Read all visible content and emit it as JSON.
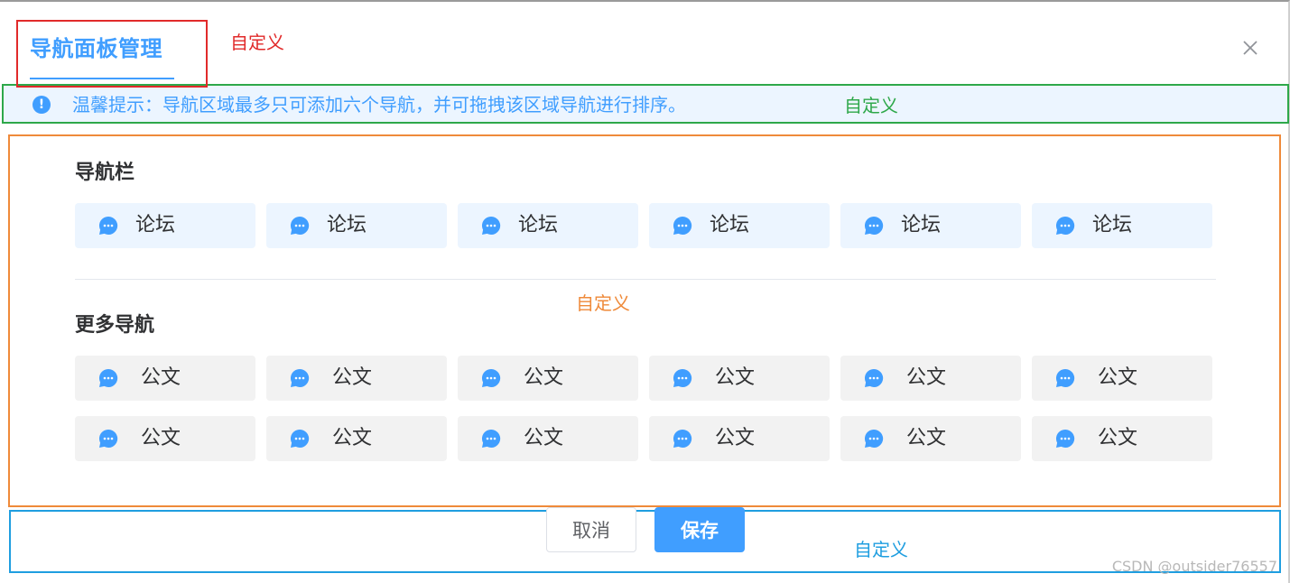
{
  "dialog": {
    "title": "导航面板管理",
    "close_icon": "close-icon"
  },
  "annotations": {
    "label": "自定义",
    "colors": {
      "header": "#e12a2a",
      "tip": "#2ea84a",
      "body": "#ef8a3a",
      "footer": "#1f9ee0"
    }
  },
  "tip": {
    "icon": "info-circle-icon",
    "text": "温馨提示：导航区域最多只可添加六个导航，并可拖拽该区域导航进行排序。"
  },
  "nav_section": {
    "title": "导航栏",
    "items": [
      {
        "label": "论坛",
        "icon": "chat-bubble-icon"
      },
      {
        "label": "论坛",
        "icon": "chat-bubble-icon"
      },
      {
        "label": "论坛",
        "icon": "chat-bubble-icon"
      },
      {
        "label": "论坛",
        "icon": "chat-bubble-icon"
      },
      {
        "label": "论坛",
        "icon": "chat-bubble-icon"
      },
      {
        "label": "论坛",
        "icon": "chat-bubble-icon"
      }
    ]
  },
  "more_section": {
    "title": "更多导航",
    "items": [
      {
        "label": "公文",
        "icon": "chat-bubble-icon"
      },
      {
        "label": "公文",
        "icon": "chat-bubble-icon"
      },
      {
        "label": "公文",
        "icon": "chat-bubble-icon"
      },
      {
        "label": "公文",
        "icon": "chat-bubble-icon"
      },
      {
        "label": "公文",
        "icon": "chat-bubble-icon"
      },
      {
        "label": "公文",
        "icon": "chat-bubble-icon"
      },
      {
        "label": "公文",
        "icon": "chat-bubble-icon"
      },
      {
        "label": "公文",
        "icon": "chat-bubble-icon"
      },
      {
        "label": "公文",
        "icon": "chat-bubble-icon"
      },
      {
        "label": "公文",
        "icon": "chat-bubble-icon"
      },
      {
        "label": "公文",
        "icon": "chat-bubble-icon"
      },
      {
        "label": "公文",
        "icon": "chat-bubble-icon"
      }
    ]
  },
  "footer": {
    "cancel_label": "取消",
    "save_label": "保存"
  },
  "watermark": "CSDN @outsider76557",
  "colors": {
    "primary": "#409eff",
    "nav_tile_bg": "#ecf5ff",
    "more_tile_bg": "#f2f2f2"
  }
}
